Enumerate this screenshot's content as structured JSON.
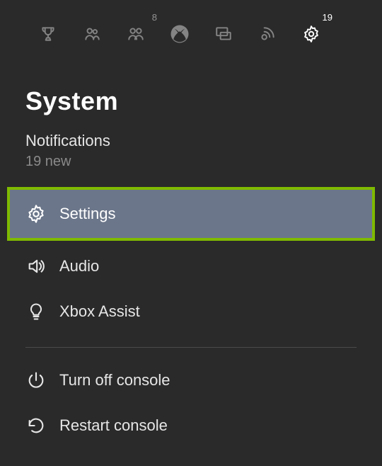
{
  "topbar": {
    "people_badge": "8",
    "settings_badge": "19"
  },
  "title": "System",
  "notifications": {
    "label": "Notifications",
    "count": "19 new"
  },
  "menu": {
    "settings": "Settings",
    "audio": "Audio",
    "assist": "Xbox Assist",
    "poweroff": "Turn off console",
    "restart": "Restart console"
  }
}
